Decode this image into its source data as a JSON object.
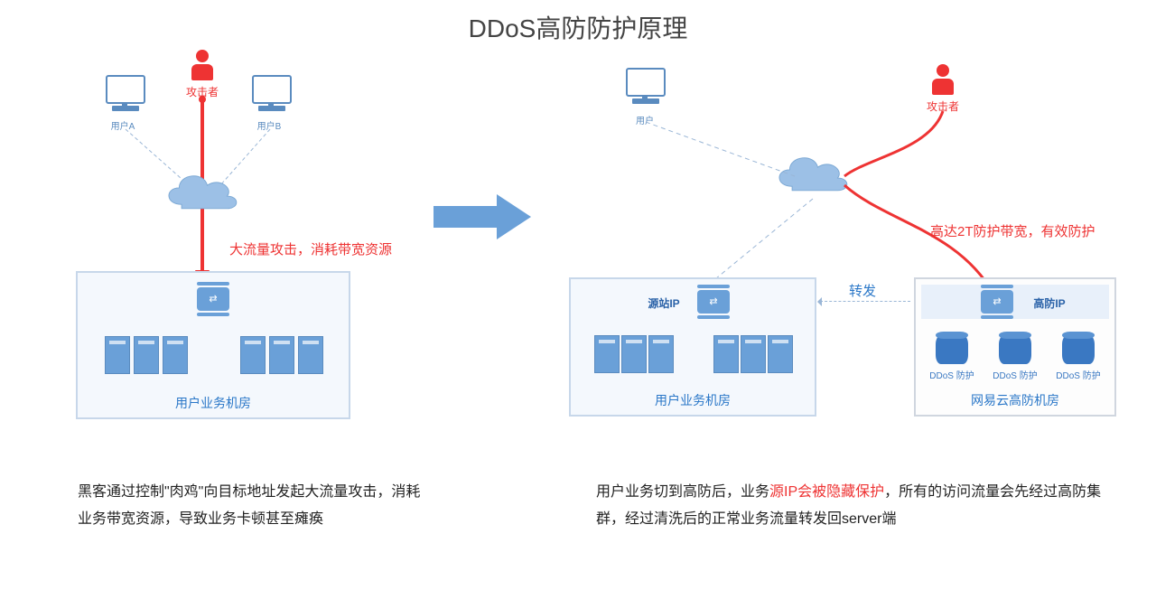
{
  "title": "DDoS高防防护原理",
  "left": {
    "attacker": "攻击者",
    "userA": "用户A",
    "userB": "用户B",
    "attack_note": "大流量攻击，消耗带宽资源",
    "dc_name": "用户业务机房",
    "desc": "黑客通过控制\"肉鸡\"向目标地址发起大流量攻击，消耗业务带宽资源，导致业务卡顿甚至瘫痪"
  },
  "right": {
    "user": "用户",
    "attacker": "攻击者",
    "protect_note": "高达2T防护带宽，有效防护",
    "origin_ip": "源站IP",
    "highdef_ip": "高防IP",
    "forward": "转发",
    "origin_dc": "用户业务机房",
    "highdef_dc": "网易云高防机房",
    "ddos_lbl": "DDoS 防护",
    "desc_pre": "用户业务切到高防后，业务",
    "desc_red": "源IP会被隐藏保护",
    "desc_post": "，所有的访问流量会先经过高防集群，经过清洗后的正常业务流量转发回server端"
  }
}
